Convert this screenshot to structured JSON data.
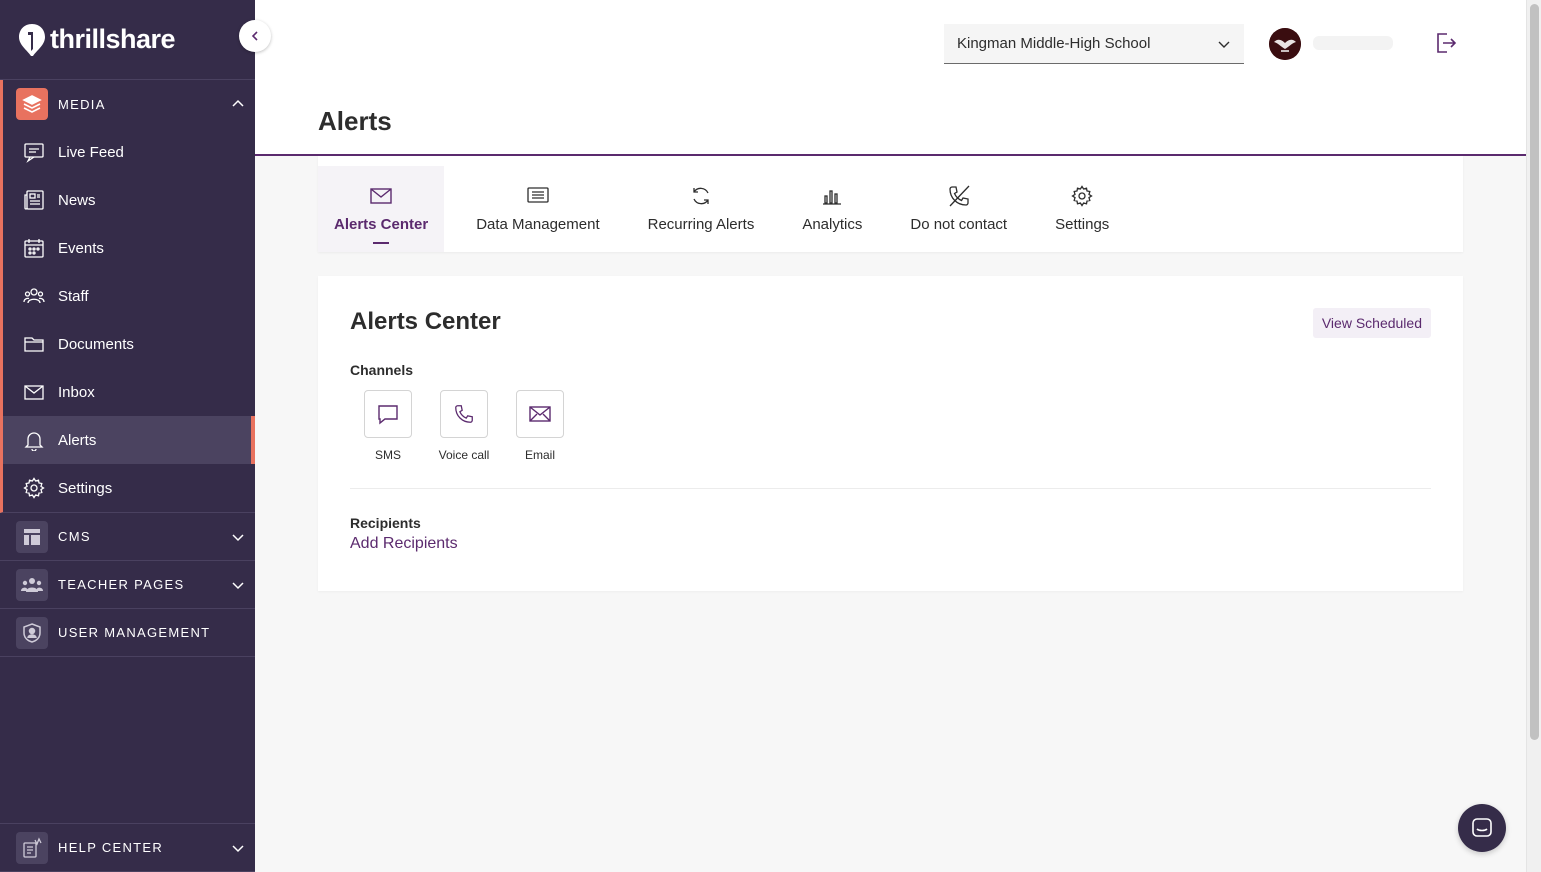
{
  "brand": {
    "name": "thrillshare"
  },
  "sidebar": {
    "media": {
      "label": "MEDIA",
      "items": [
        {
          "label": "Live Feed",
          "icon": "live-feed-icon"
        },
        {
          "label": "News",
          "icon": "news-icon"
        },
        {
          "label": "Events",
          "icon": "calendar-icon"
        },
        {
          "label": "Staff",
          "icon": "staff-icon"
        },
        {
          "label": "Documents",
          "icon": "folder-icon"
        },
        {
          "label": "Inbox",
          "icon": "mail-icon"
        },
        {
          "label": "Alerts",
          "icon": "bell-icon",
          "active": true
        },
        {
          "label": "Settings",
          "icon": "gear-icon"
        }
      ]
    },
    "cms": {
      "label": "CMS"
    },
    "teacher_pages": {
      "label": "TEACHER PAGES"
    },
    "user_management": {
      "label": "USER MANAGEMENT"
    },
    "help_center": {
      "label": "HELP CENTER"
    }
  },
  "topbar": {
    "school": "Kingman Middle-High School"
  },
  "page": {
    "title": "Alerts",
    "tabs": [
      {
        "label": "Alerts Center",
        "icon": "envelope-icon",
        "active": true
      },
      {
        "label": "Data Management",
        "icon": "data-icon"
      },
      {
        "label": "Recurring Alerts",
        "icon": "refresh-icon"
      },
      {
        "label": "Analytics",
        "icon": "bar-chart-icon"
      },
      {
        "label": "Do not contact",
        "icon": "no-call-icon"
      },
      {
        "label": "Settings",
        "icon": "gear-icon"
      }
    ]
  },
  "card": {
    "title": "Alerts Center",
    "view_scheduled": "View Scheduled",
    "channels_label": "Channels",
    "channels": [
      {
        "label": "SMS",
        "icon": "chat-icon"
      },
      {
        "label": "Voice call",
        "icon": "phone-icon"
      },
      {
        "label": "Email",
        "icon": "envelope-icon"
      }
    ],
    "recipients_label": "Recipients",
    "add_recipients": "Add Recipients"
  },
  "colors": {
    "sidebar_bg": "#352c49",
    "accent_coral": "#e8725f",
    "brand_purple": "#5b2a6e"
  }
}
